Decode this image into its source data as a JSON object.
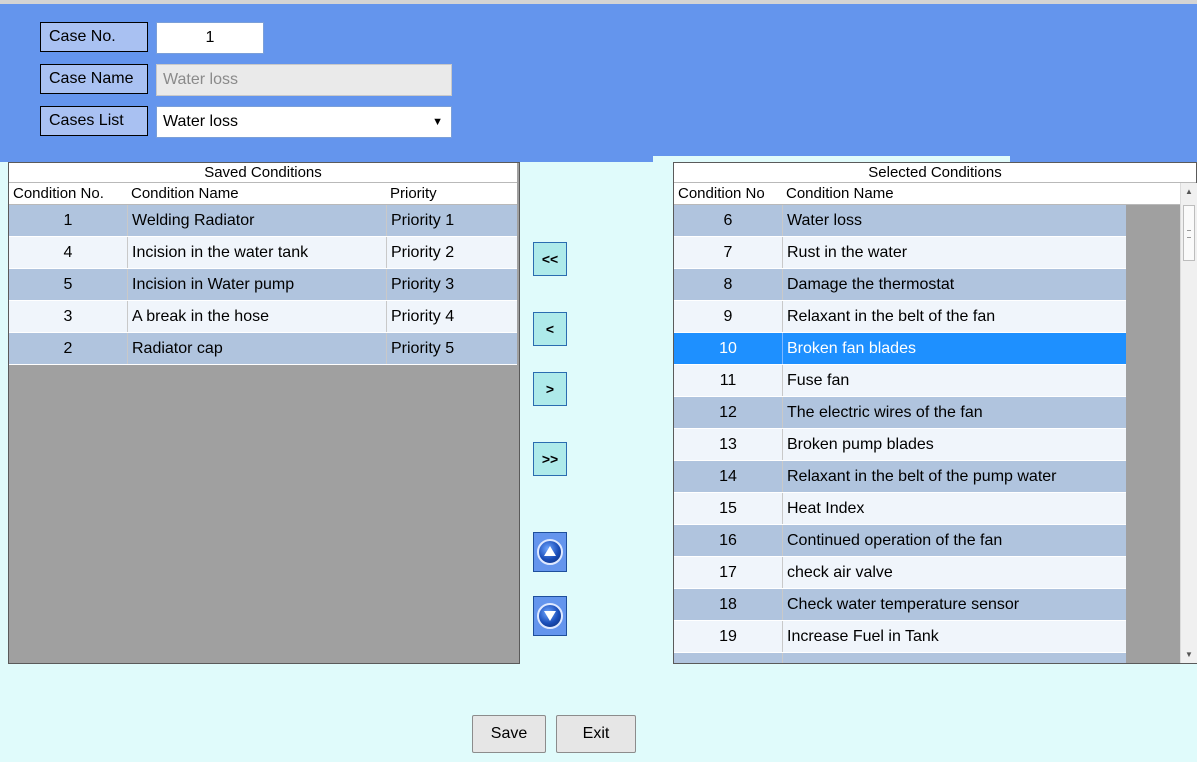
{
  "header": {
    "case_no_label": "Case No.",
    "case_no_value": "1",
    "case_name_label": "Case Name",
    "case_name_value": "Water loss",
    "cases_list_label": "Cases List",
    "cases_list_value": "Water loss"
  },
  "saved": {
    "title": "Saved Conditions",
    "columns": [
      "Condition No.",
      "Condition Name",
      "Priority"
    ],
    "rows": [
      {
        "no": "1",
        "name": "Welding Radiator",
        "priority": "Priority 1"
      },
      {
        "no": "4",
        "name": "Incision in the water tank",
        "priority": "Priority 2"
      },
      {
        "no": "5",
        "name": "Incision in Water pump",
        "priority": "Priority 3"
      },
      {
        "no": "3",
        "name": "A break in the hose",
        "priority": "Priority 4"
      },
      {
        "no": "2",
        "name": "Radiator cap",
        "priority": "Priority 5"
      }
    ]
  },
  "selected": {
    "title": "Selected Conditions",
    "columns": [
      "Condition No",
      "Condition Name"
    ],
    "rows": [
      {
        "no": "6",
        "name": "Water loss"
      },
      {
        "no": "7",
        "name": "Rust in the water"
      },
      {
        "no": "8",
        "name": "Damage the thermostat"
      },
      {
        "no": "9",
        "name": "Relaxant in the belt of the fan"
      },
      {
        "no": "10",
        "name": "Broken fan blades"
      },
      {
        "no": "11",
        "name": "Fuse fan"
      },
      {
        "no": "12",
        "name": "The electric wires of the fan"
      },
      {
        "no": "13",
        "name": "Broken pump blades"
      },
      {
        "no": "14",
        "name": "Relaxant in the belt of the pump water"
      },
      {
        "no": "15",
        "name": "Heat Index"
      },
      {
        "no": "16",
        "name": "Continued operation of the fan"
      },
      {
        "no": "17",
        "name": "check air valve"
      },
      {
        "no": "18",
        "name": "Check water temperature sensor"
      },
      {
        "no": "19",
        "name": "Increase  Fuel in Tank"
      }
    ],
    "selected_index": 4
  },
  "middle_buttons": {
    "move_all_left": "<<",
    "move_left": "<",
    "move_right": ">",
    "move_all_right": ">>"
  },
  "bottom": {
    "save": "Save",
    "exit": "Exit"
  },
  "colors": {
    "header_bg": "#6495ed",
    "row_odd": "#b0c4de",
    "row_even": "#f0f5fb",
    "row_selected": "#1e90ff",
    "page_bg": "#e0fbfb"
  }
}
